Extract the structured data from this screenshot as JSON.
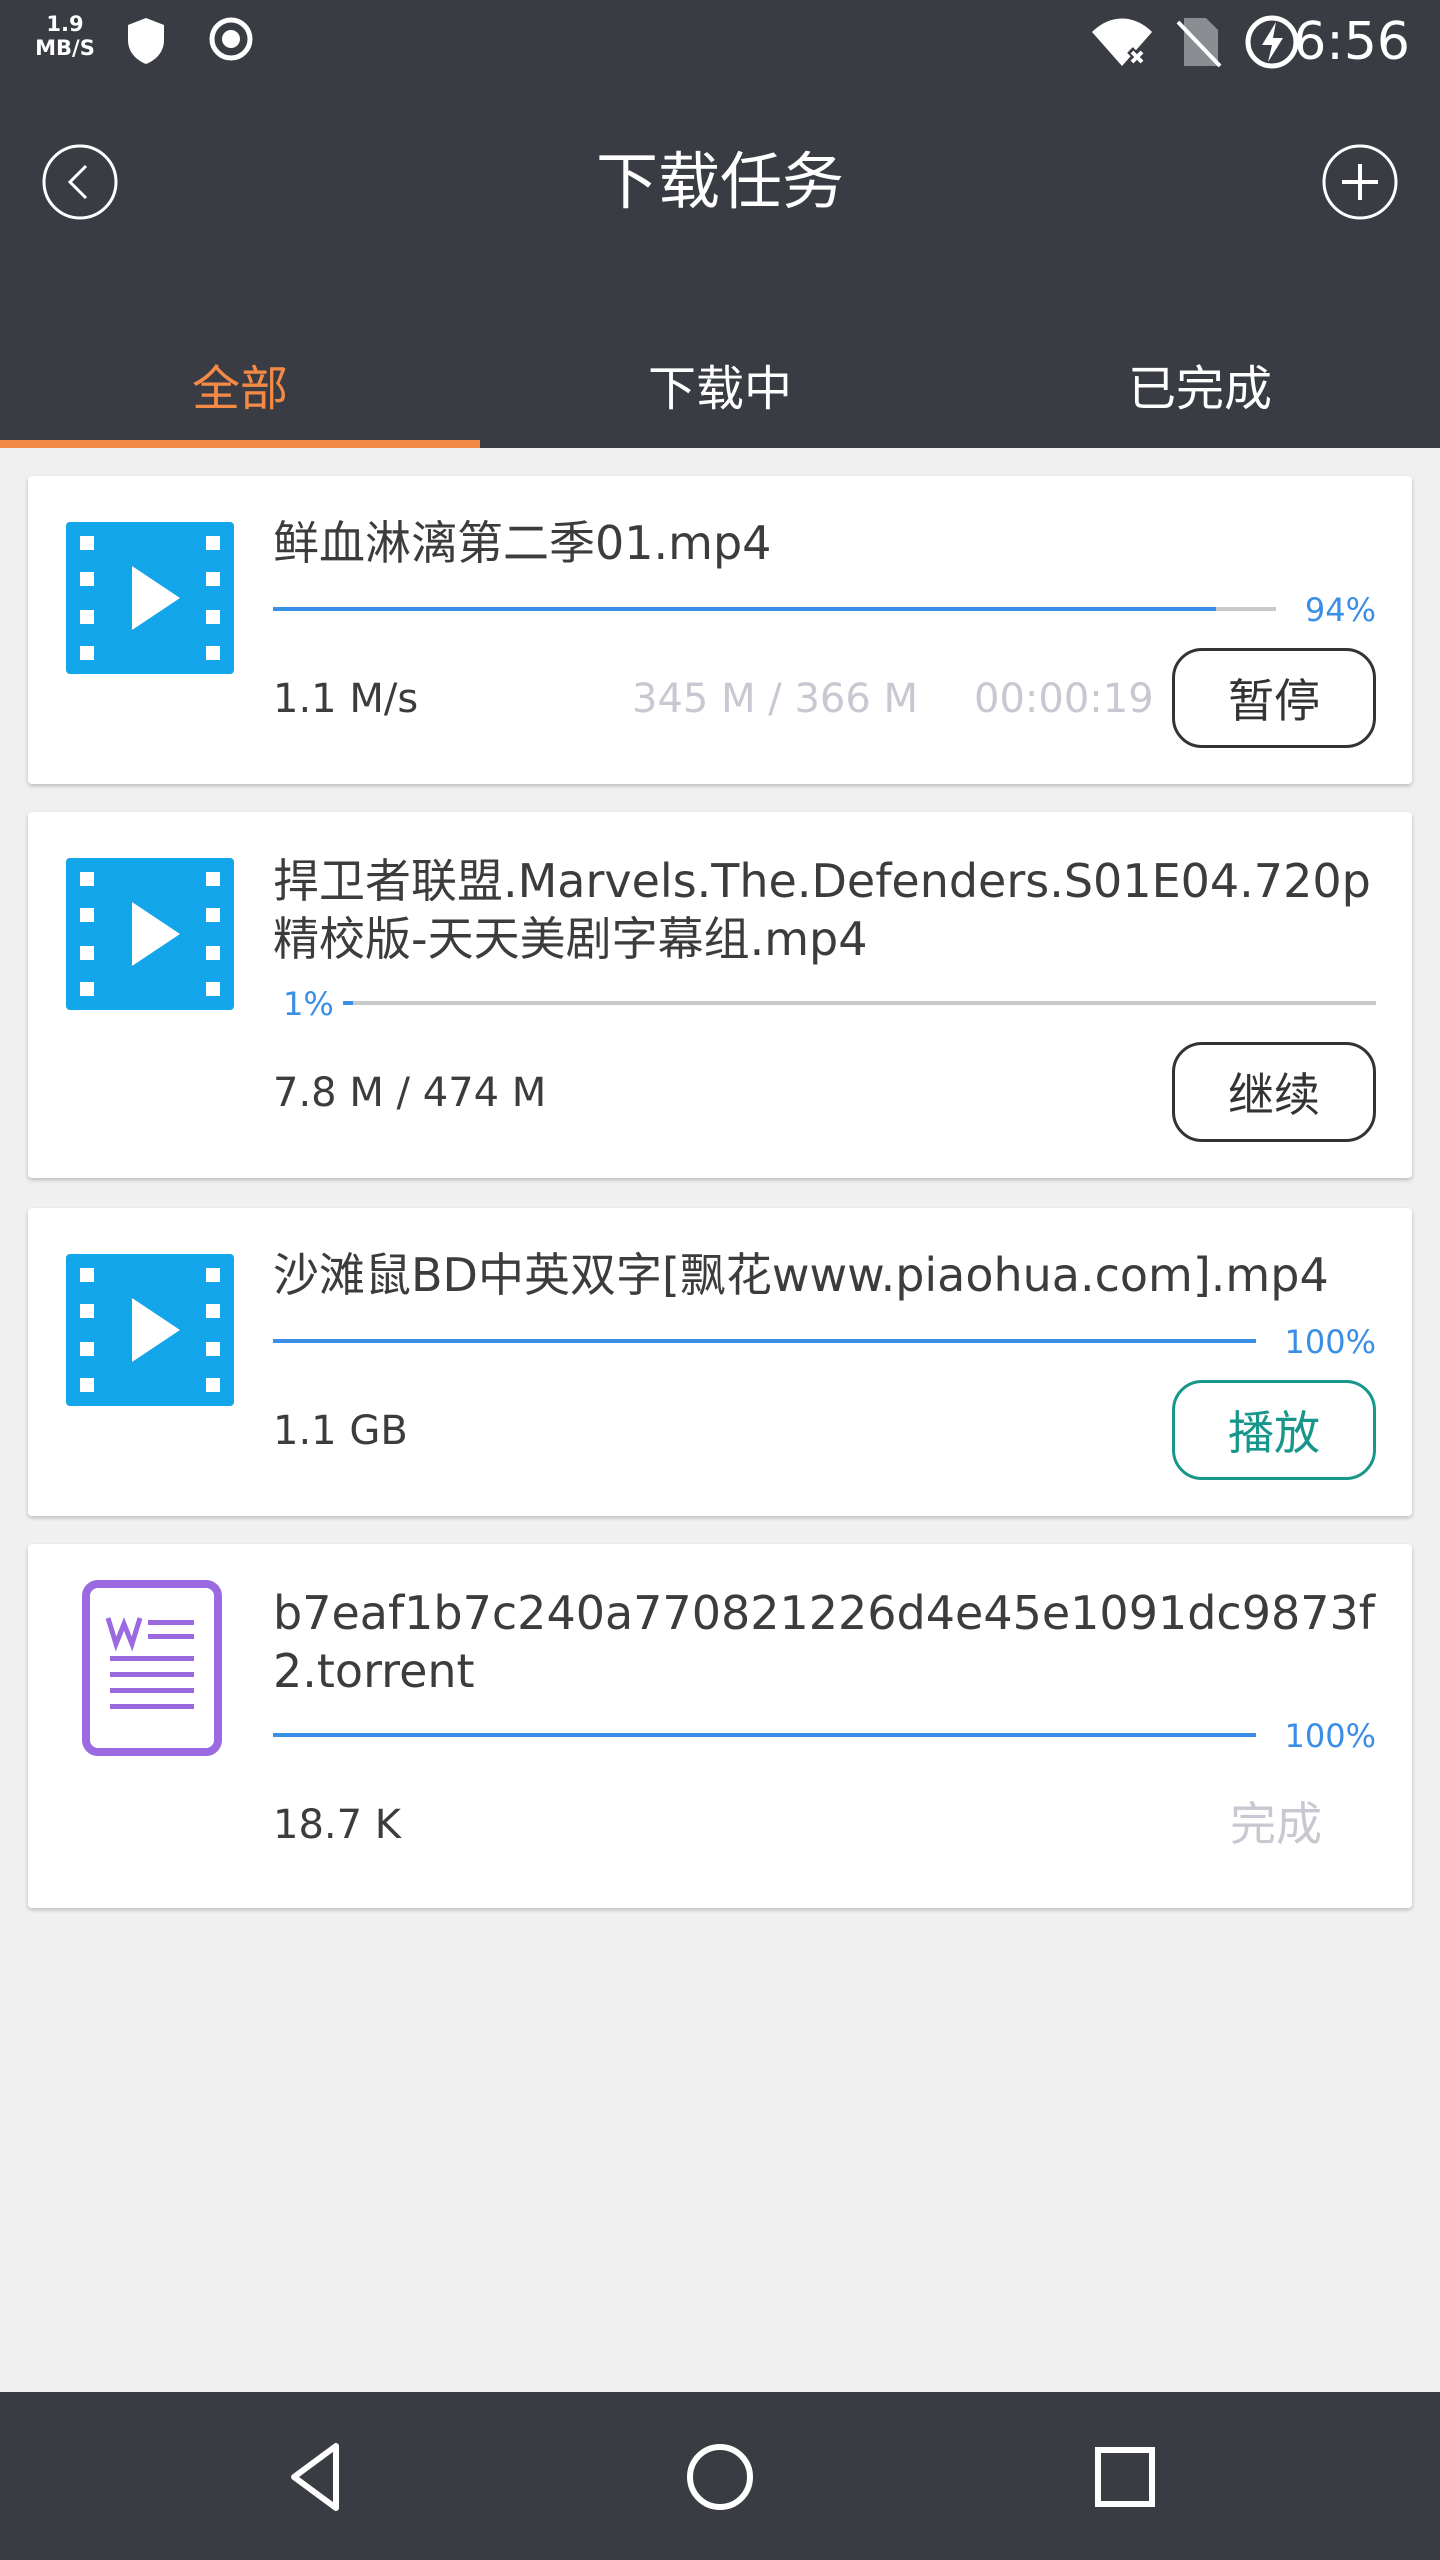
{
  "status_bar": {
    "net_speed_value": "1.9",
    "net_speed_unit": "MB/S",
    "time": "6:56",
    "icons": [
      "shield-icon",
      "record-icon",
      "wifi-icon",
      "no-sim-icon",
      "battery-charging-icon"
    ]
  },
  "header": {
    "title": "下载任务",
    "back_icon": "back-circle-icon",
    "add_icon": "add-circle-icon"
  },
  "tabs": [
    {
      "label": "全部",
      "active": true
    },
    {
      "label": "下载中",
      "active": false
    },
    {
      "label": "已完成",
      "active": false
    }
  ],
  "colors": {
    "accent": "#f58a47",
    "progress": "#3a8ee6",
    "video_icon": "#13a5ea",
    "doc_icon": "#9b6ae0",
    "play_button": "#16978a",
    "bar_bg": "#393c43"
  },
  "tasks": [
    {
      "icon": "video-file-icon",
      "name": "鲜血淋漓第二季01.mp4",
      "progress": 0.94,
      "percent_label": "94%",
      "speed": "1.1 M/s",
      "size": "345 M / 366 M",
      "eta": "00:00:19",
      "action": "暂停"
    },
    {
      "icon": "video-file-icon",
      "name": "捍卫者联盟.Marvels.The.Defenders.S01E04.720p精校版-天天美剧字幕组.mp4",
      "progress": 0.01,
      "percent_label": "1%",
      "size": "7.8 M / 474 M",
      "action": "继续"
    },
    {
      "icon": "video-file-icon",
      "name": "沙滩鼠BD中英双字[飘花www.piaohua.com].mp4",
      "progress": 1.0,
      "percent_label": "100%",
      "size": "1.1 GB",
      "action": "播放"
    },
    {
      "icon": "document-file-icon",
      "name": "b7eaf1b7c240a770821226d4e45e1091dc9873f2.torrent",
      "progress": 1.0,
      "percent_label": "100%",
      "size": "18.7 K",
      "action": "完成"
    }
  ],
  "nav_bar": [
    "back-triangle-icon",
    "home-circle-icon",
    "recents-square-icon"
  ]
}
